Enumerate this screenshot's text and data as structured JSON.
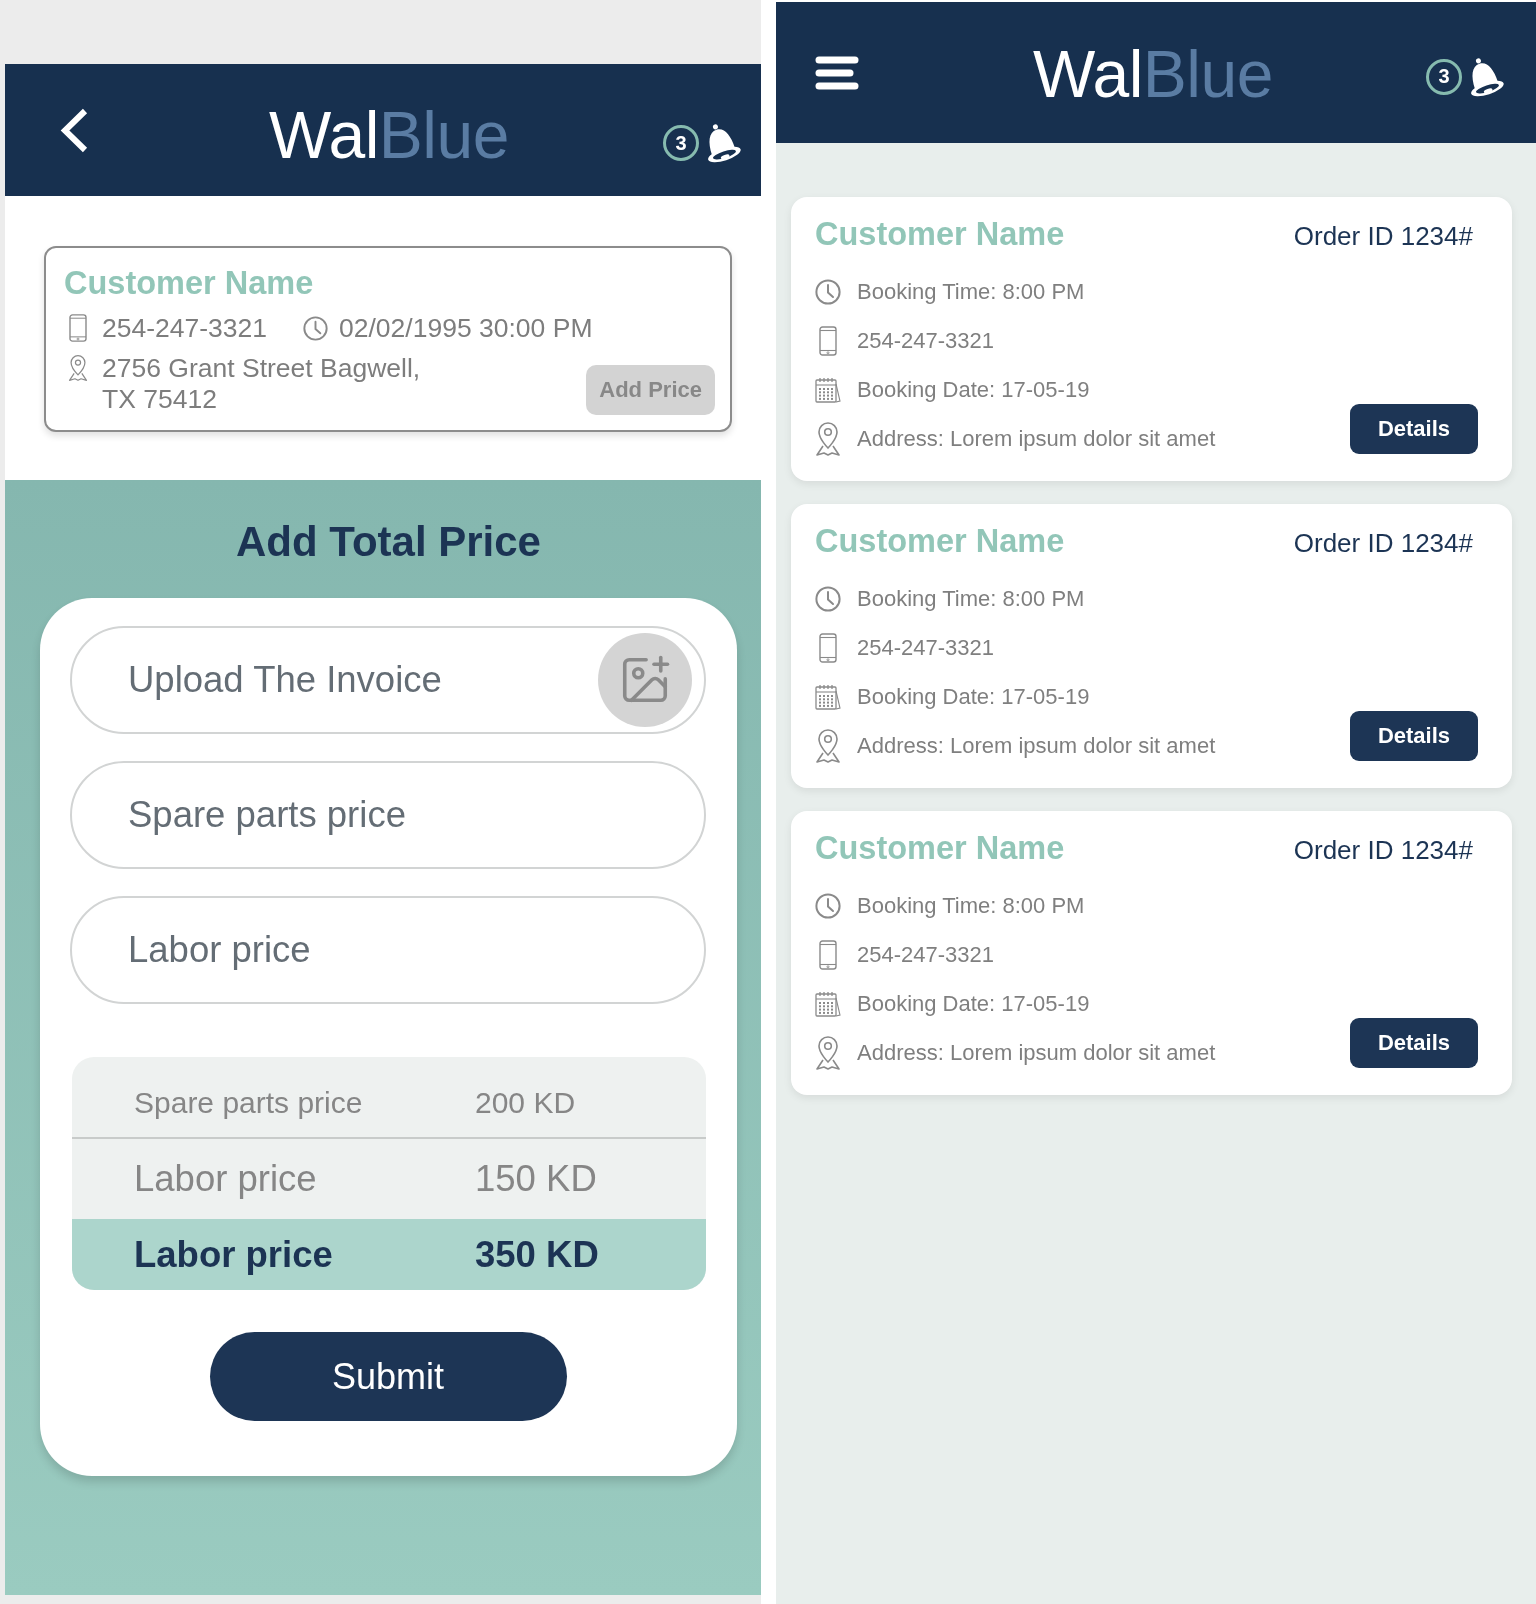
{
  "price_screen": {
    "header": {
      "logo": {
        "primary": "Wal",
        "secondary": "Blue"
      },
      "badge": "3"
    },
    "customer": {
      "name": "Customer Name",
      "details": [
        {
          "kind": "phone",
          "text": "254-247-3321"
        },
        {
          "kind": "time",
          "text": "02/02/1995 30:00 PM"
        },
        {
          "kind": "address",
          "text": "2756 Grant Street Bagwell, TX 75412"
        }
      ],
      "button": "Add Price"
    },
    "title": "Add Total Price",
    "fields": [
      {
        "kind": "upload",
        "label": "Upload The Invoice"
      },
      {
        "kind": "text",
        "placeholder": "Spare parts price"
      },
      {
        "kind": "text",
        "placeholder": "Labor price"
      }
    ],
    "summary": [
      {
        "kind": "item",
        "label": "Spare parts price",
        "value": "200 KD"
      },
      {
        "kind": "item",
        "label": "Labor price",
        "value": "150 KD"
      },
      {
        "kind": "total",
        "label": "Labor price",
        "value": "350 KD"
      }
    ],
    "submit": "Submit"
  },
  "orders_screen": {
    "header": {
      "logo": {
        "primary": "Wal",
        "secondary": "Blue"
      },
      "badge": "3"
    },
    "orders": [
      {
        "customer": "Customer Name",
        "order_id": "Order ID 1234#",
        "details": [
          {
            "kind": "time",
            "text": "Booking Time: 8:00 PM"
          },
          {
            "kind": "phone",
            "text": "254-247-3321"
          },
          {
            "kind": "date",
            "text": "Booking Date: 17-05-19"
          },
          {
            "kind": "address",
            "text": "Address: Lorem ipsum dolor sit amet"
          }
        ],
        "button": "Details"
      },
      {
        "customer": "Customer Name",
        "order_id": "Order ID 1234#",
        "details": [
          {
            "kind": "time",
            "text": "Booking Time: 8:00 PM"
          },
          {
            "kind": "phone",
            "text": "254-247-3321"
          },
          {
            "kind": "date",
            "text": "Booking Date: 17-05-19"
          },
          {
            "kind": "address",
            "text": "Address: Lorem ipsum dolor sit amet"
          }
        ],
        "button": "Details"
      },
      {
        "customer": "Customer Name",
        "order_id": "Order ID 1234#",
        "details": [
          {
            "kind": "time",
            "text": "Booking Time: 8:00 PM"
          },
          {
            "kind": "phone",
            "text": "254-247-3321"
          },
          {
            "kind": "date",
            "text": "Booking Date: 17-05-19"
          },
          {
            "kind": "address",
            "text": "Address: Lorem ipsum dolor sit amet"
          }
        ],
        "button": "Details"
      }
    ]
  }
}
